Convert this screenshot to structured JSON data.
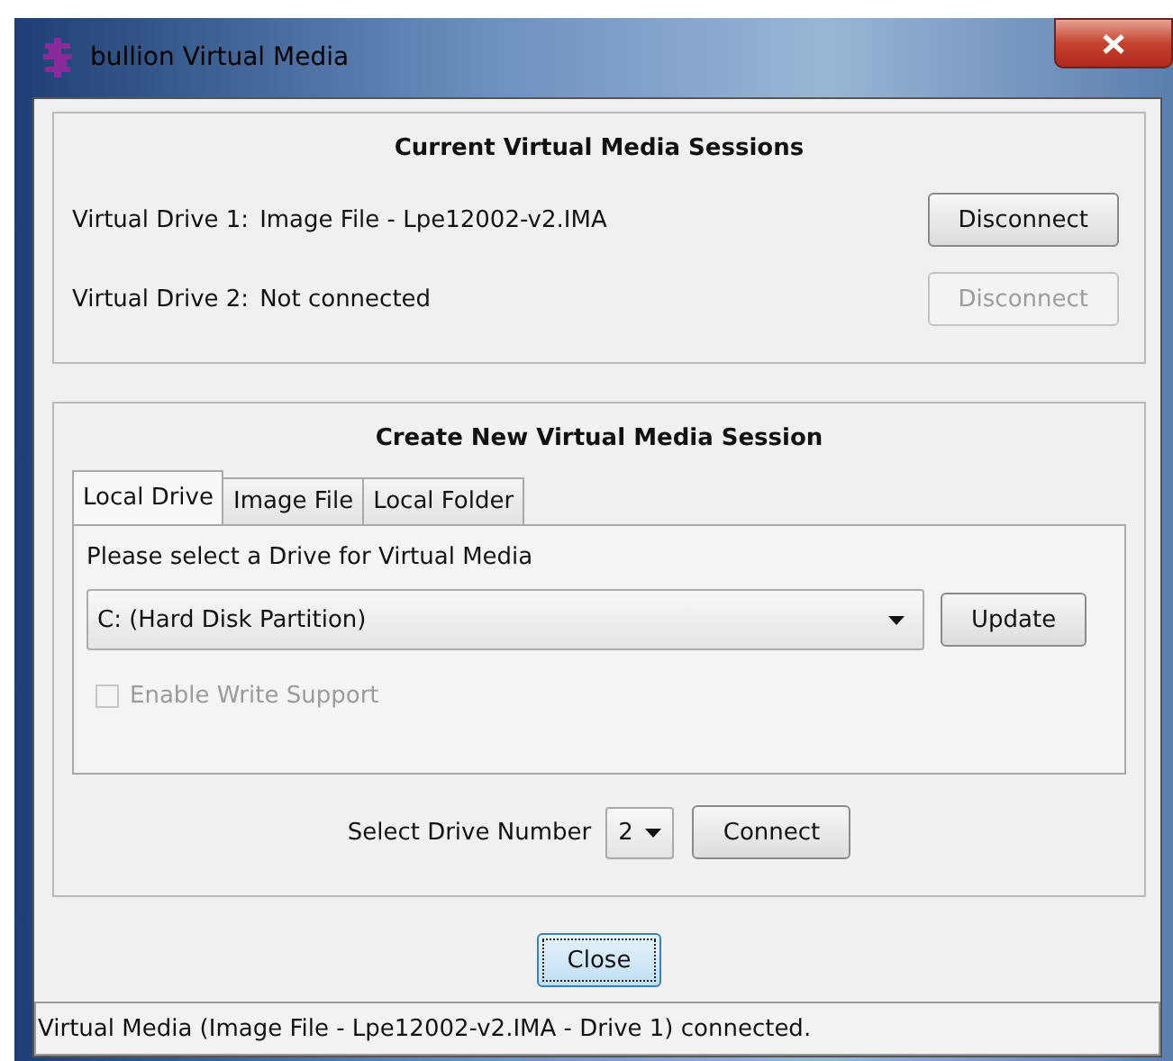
{
  "window": {
    "title": "bullion Virtual Media"
  },
  "sessions": {
    "title": "Current Virtual Media Sessions",
    "drives": [
      {
        "label": "Virtual Drive 1:",
        "value": "Image File - Lpe12002-v2.IMA",
        "button": "Disconnect",
        "disabled": false
      },
      {
        "label": "Virtual Drive 2:",
        "value": "Not connected",
        "button": "Disconnect",
        "disabled": true
      }
    ]
  },
  "create": {
    "title": "Create New Virtual Media Session",
    "tabs": [
      {
        "label": "Local Drive",
        "selected": true
      },
      {
        "label": "Image File",
        "selected": false
      },
      {
        "label": "Local Folder",
        "selected": false
      }
    ],
    "prompt": "Please select a Drive for Virtual Media",
    "drive_select": {
      "value": "C: (Hard Disk Partition)"
    },
    "update_button": "Update",
    "write_support": {
      "label": "Enable Write Support",
      "checked": false,
      "disabled": true
    },
    "drive_number": {
      "label": "Select Drive Number",
      "value": "2"
    },
    "connect_button": "Connect"
  },
  "close_button": {
    "label": "Close",
    "focused": true
  },
  "status_bar": "Virtual Media (Image File - Lpe12002-v2.IMA - Drive 1) connected."
}
